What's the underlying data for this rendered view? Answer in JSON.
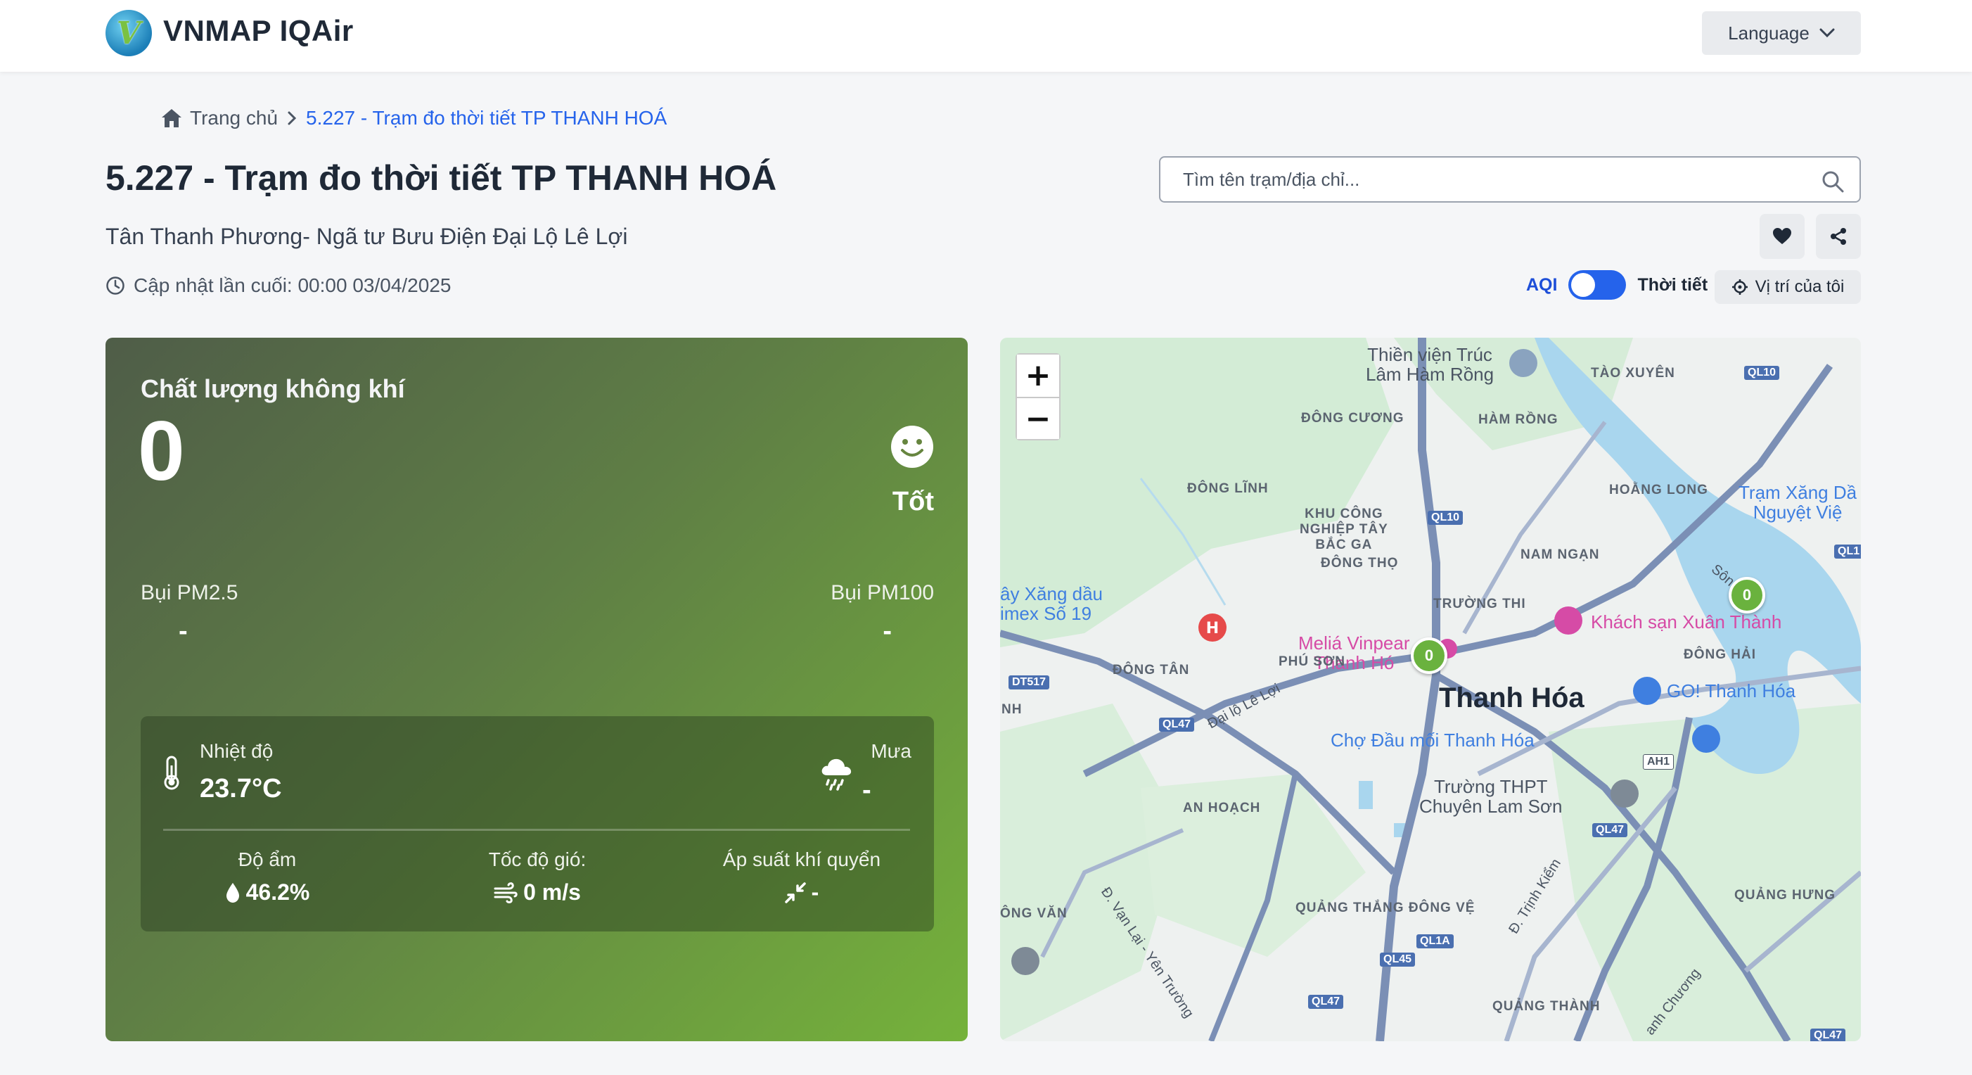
{
  "header": {
    "brand": "VNMAP IQAir",
    "language_label": "Language"
  },
  "breadcrumb": {
    "home": "Trang chủ",
    "current": "5.227 - Trạm đo thời tiết TP THANH HOÁ"
  },
  "station": {
    "title": "5.227 - Trạm đo thời tiết TP THANH HOÁ",
    "address": "Tân Thanh Phương- Ngã tư Bưu Điện Đại Lộ Lê Lợi",
    "updated": "Cập nhật lần cuối: 00:00 03/04/2025"
  },
  "search": {
    "placeholder": "Tìm tên trạm/địa chỉ..."
  },
  "toggle": {
    "left": "AQI",
    "right": "Thời tiết"
  },
  "location_button": "Vị trí của tôi",
  "aqi_card": {
    "label": "Chất lượng không khí",
    "value": "0",
    "status": "Tốt",
    "pm25_label": "Bụi PM2.5",
    "pm25_value": "-",
    "pm100_label": "Bụi PM100",
    "pm100_value": "-",
    "temp_label": "Nhiệt độ",
    "temp_value": "23.7°C",
    "rain_label": "Mưa",
    "rain_value": "-",
    "humidity_label": "Độ ẩm",
    "humidity_value": "46.2%",
    "wind_label": "Tốc độ gió:",
    "wind_value": "0 m/s",
    "pressure_label": "Áp suất khí quyển",
    "pressure_value": "-"
  },
  "map": {
    "zoom_in": "+",
    "zoom_out": "−",
    "city": "Thanh Hóa",
    "labels": {
      "thien_vien": "Thiền viện Trúc\nLâm Hàm Rồng",
      "tao_xuyen": "TÀO XUYÊN",
      "dong_cuong": "ĐÔNG CƯƠNG",
      "ham_rong": "HÀM RỒNG",
      "dong_linh": "ĐÔNG LĨNH",
      "hoang_long": "HOẰNG LONG",
      "tram_xang": "Trạm Xăng Dầ\nNguyệt Việ",
      "kcn": "KHU CÔNG\nNGHIỆP TÂY\nBẮC GA",
      "dong_tho": "ĐÔNG THỌ",
      "nam_ngan": "NAM NGẠN",
      "cay_xang": "ây Xăng dầu\nimex Số 19",
      "truong_thi": "TRƯỜNG THI",
      "khach_san": "Khách sạn Xuân Thành",
      "melia": "Meliá Vinpear\nThanh Hó",
      "dong_hai": "ĐÔNG HẢI",
      "dong_tan": "ĐÔNG TÂN",
      "phu_son": "PHÚ SƠN",
      "go": "GO! Thanh Hóa",
      "dai_lo": "Đại lộ Lê Lợi",
      "cho_dau_moi": "Chợ Đầu mối Thanh Hóa",
      "truong_thpt": "Trường THPT\nChuyên Lam Sơn",
      "an_hoach": "AN HOẠCH",
      "ong_van": "ÔNG VĂN",
      "quang_thang": "QUẢNG THẮNG ĐÔNG VỆ",
      "quang_hung": "QUẢNG HƯNG",
      "quang_thanh": "QUẢNG THÀNH",
      "d_trinh_kiem": "Đ. Trịnh Kiểm",
      "d_van_lai": "Đ. Vạn Lại - Yên Trường",
      "anh_chuong": "anh Chương",
      "son": "Sôn",
      "nh": "NH"
    },
    "roads": [
      "QL10",
      "QL10",
      "QL1",
      "DT517",
      "QL47",
      "QL47",
      "QL1A",
      "QL45",
      "QL47",
      "QL47",
      "AH1"
    ],
    "markers": [
      "0",
      "0"
    ]
  }
}
